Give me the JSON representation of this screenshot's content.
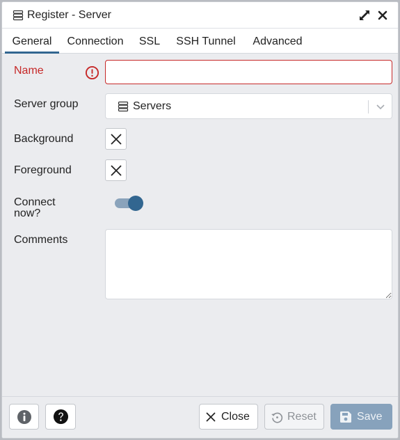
{
  "window": {
    "title": "Register - Server"
  },
  "tabs": [
    {
      "label": "General",
      "active": true
    },
    {
      "label": "Connection",
      "active": false
    },
    {
      "label": "SSL",
      "active": false
    },
    {
      "label": "SSH Tunnel",
      "active": false
    },
    {
      "label": "Advanced",
      "active": false
    }
  ],
  "form": {
    "name": {
      "label": "Name",
      "value": "",
      "has_error": true
    },
    "server_group": {
      "label": "Server group",
      "value": "Servers"
    },
    "background": {
      "label": "Background"
    },
    "foreground": {
      "label": "Foreground"
    },
    "connect_now": {
      "label_line1": "Connect",
      "label_line2": "now?",
      "enabled": true
    },
    "comments": {
      "label": "Comments",
      "value": ""
    }
  },
  "footer": {
    "close_label": "Close",
    "reset_label": "Reset",
    "save_label": "Save"
  },
  "icons": {
    "title": "server-icon",
    "expand": "expand-icon",
    "close": "close-icon",
    "error": "error-icon",
    "server_group": "server-icon",
    "dropdown": "chevron-down-icon",
    "background_clear": "x-icon",
    "foreground_clear": "x-icon",
    "info": "info-icon",
    "help": "help-icon",
    "close_button": "x-icon",
    "reset_button": "reset-icon",
    "save_button": "save-icon"
  },
  "colors": {
    "accent": "#326690",
    "error": "#c62828",
    "save_disabled": "#87a2bc"
  }
}
